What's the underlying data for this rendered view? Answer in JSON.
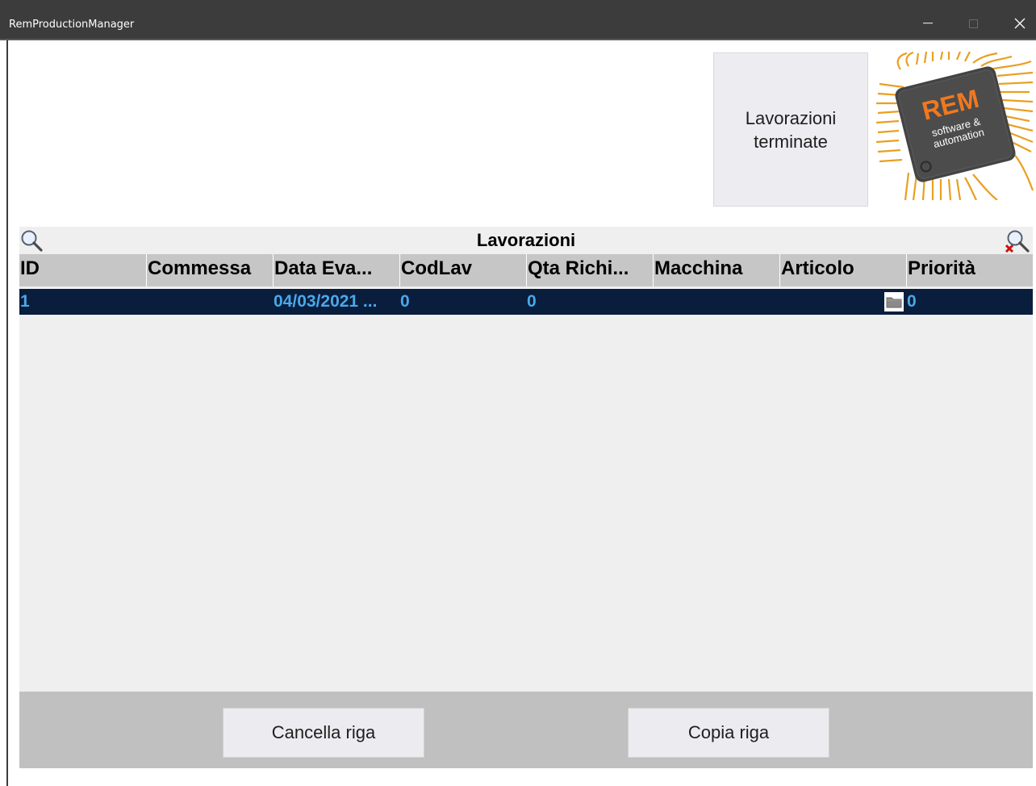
{
  "window": {
    "title": "RemProductionManager",
    "minimize_glyph": "—",
    "maximize_glyph": "☐",
    "close_glyph": "✕"
  },
  "toolbar": {
    "terminate_label_line1": "Lavorazioni",
    "terminate_label_line2": "terminate"
  },
  "logo": {
    "brand": "REM",
    "tagline_line1": "software &",
    "tagline_line2": "automation"
  },
  "grid": {
    "title": "Lavorazioni",
    "search_icon": "magnifier-icon",
    "clear_icon": "magnifier-clear-icon",
    "columns": [
      "ID",
      "Commessa",
      "Data Eva...",
      "CodLav",
      "Qta Richi...",
      "Macchina",
      "Articolo",
      "Priorità"
    ],
    "rows": [
      {
        "id": "1",
        "commessa": "",
        "data_eva": "04/03/2021 ...",
        "codlav": "0",
        "qta_richi": "0",
        "macchina": "",
        "articolo": "",
        "priorita": "0"
      }
    ]
  },
  "actions": {
    "delete_label": "Cancella riga",
    "copy_label": "Copia riga"
  },
  "colors": {
    "titlebar": "#3c3c3c",
    "selected_row": "#091d3d",
    "selected_text": "#4aa8e8",
    "header_bg": "#c6c6c6",
    "bottom_bar": "#c0c0c0"
  }
}
